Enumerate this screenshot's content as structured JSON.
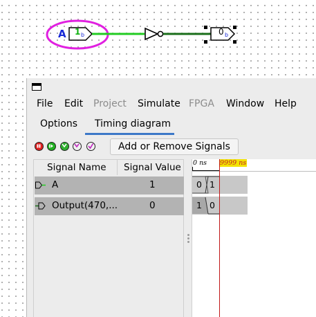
{
  "circuit": {
    "input_pin_label": "A",
    "input_pin_value": "1",
    "input_pin_bits": "b",
    "output_pin_value": "0",
    "output_pin_bits": "b"
  },
  "menubar": {
    "items": [
      "File",
      "Edit",
      "Project",
      "Simulate",
      "FPGA",
      "Window",
      "Help"
    ]
  },
  "tabs": [
    "Options",
    "Timing diagram"
  ],
  "toolbar": {
    "add_remove_label": "Add or Remove Signals"
  },
  "signal_table": {
    "headers": [
      "Signal Name",
      "Signal Value"
    ],
    "rows": [
      {
        "name": "A",
        "value": "1"
      },
      {
        "name": "Output(470,...",
        "value": "0"
      }
    ]
  },
  "timing": {
    "start_label": "0 ns",
    "cursor_label": "9999 ns",
    "waves": [
      {
        "before": "0",
        "after": "1"
      },
      {
        "before": "1",
        "after": "0"
      }
    ]
  },
  "colors": {
    "selection_ellipse": "#e020e0",
    "wire_high": "#22cc22",
    "wire_low": "#1a6e1a",
    "cursor": "#c01818",
    "tab_underline": "#3c78c8"
  }
}
